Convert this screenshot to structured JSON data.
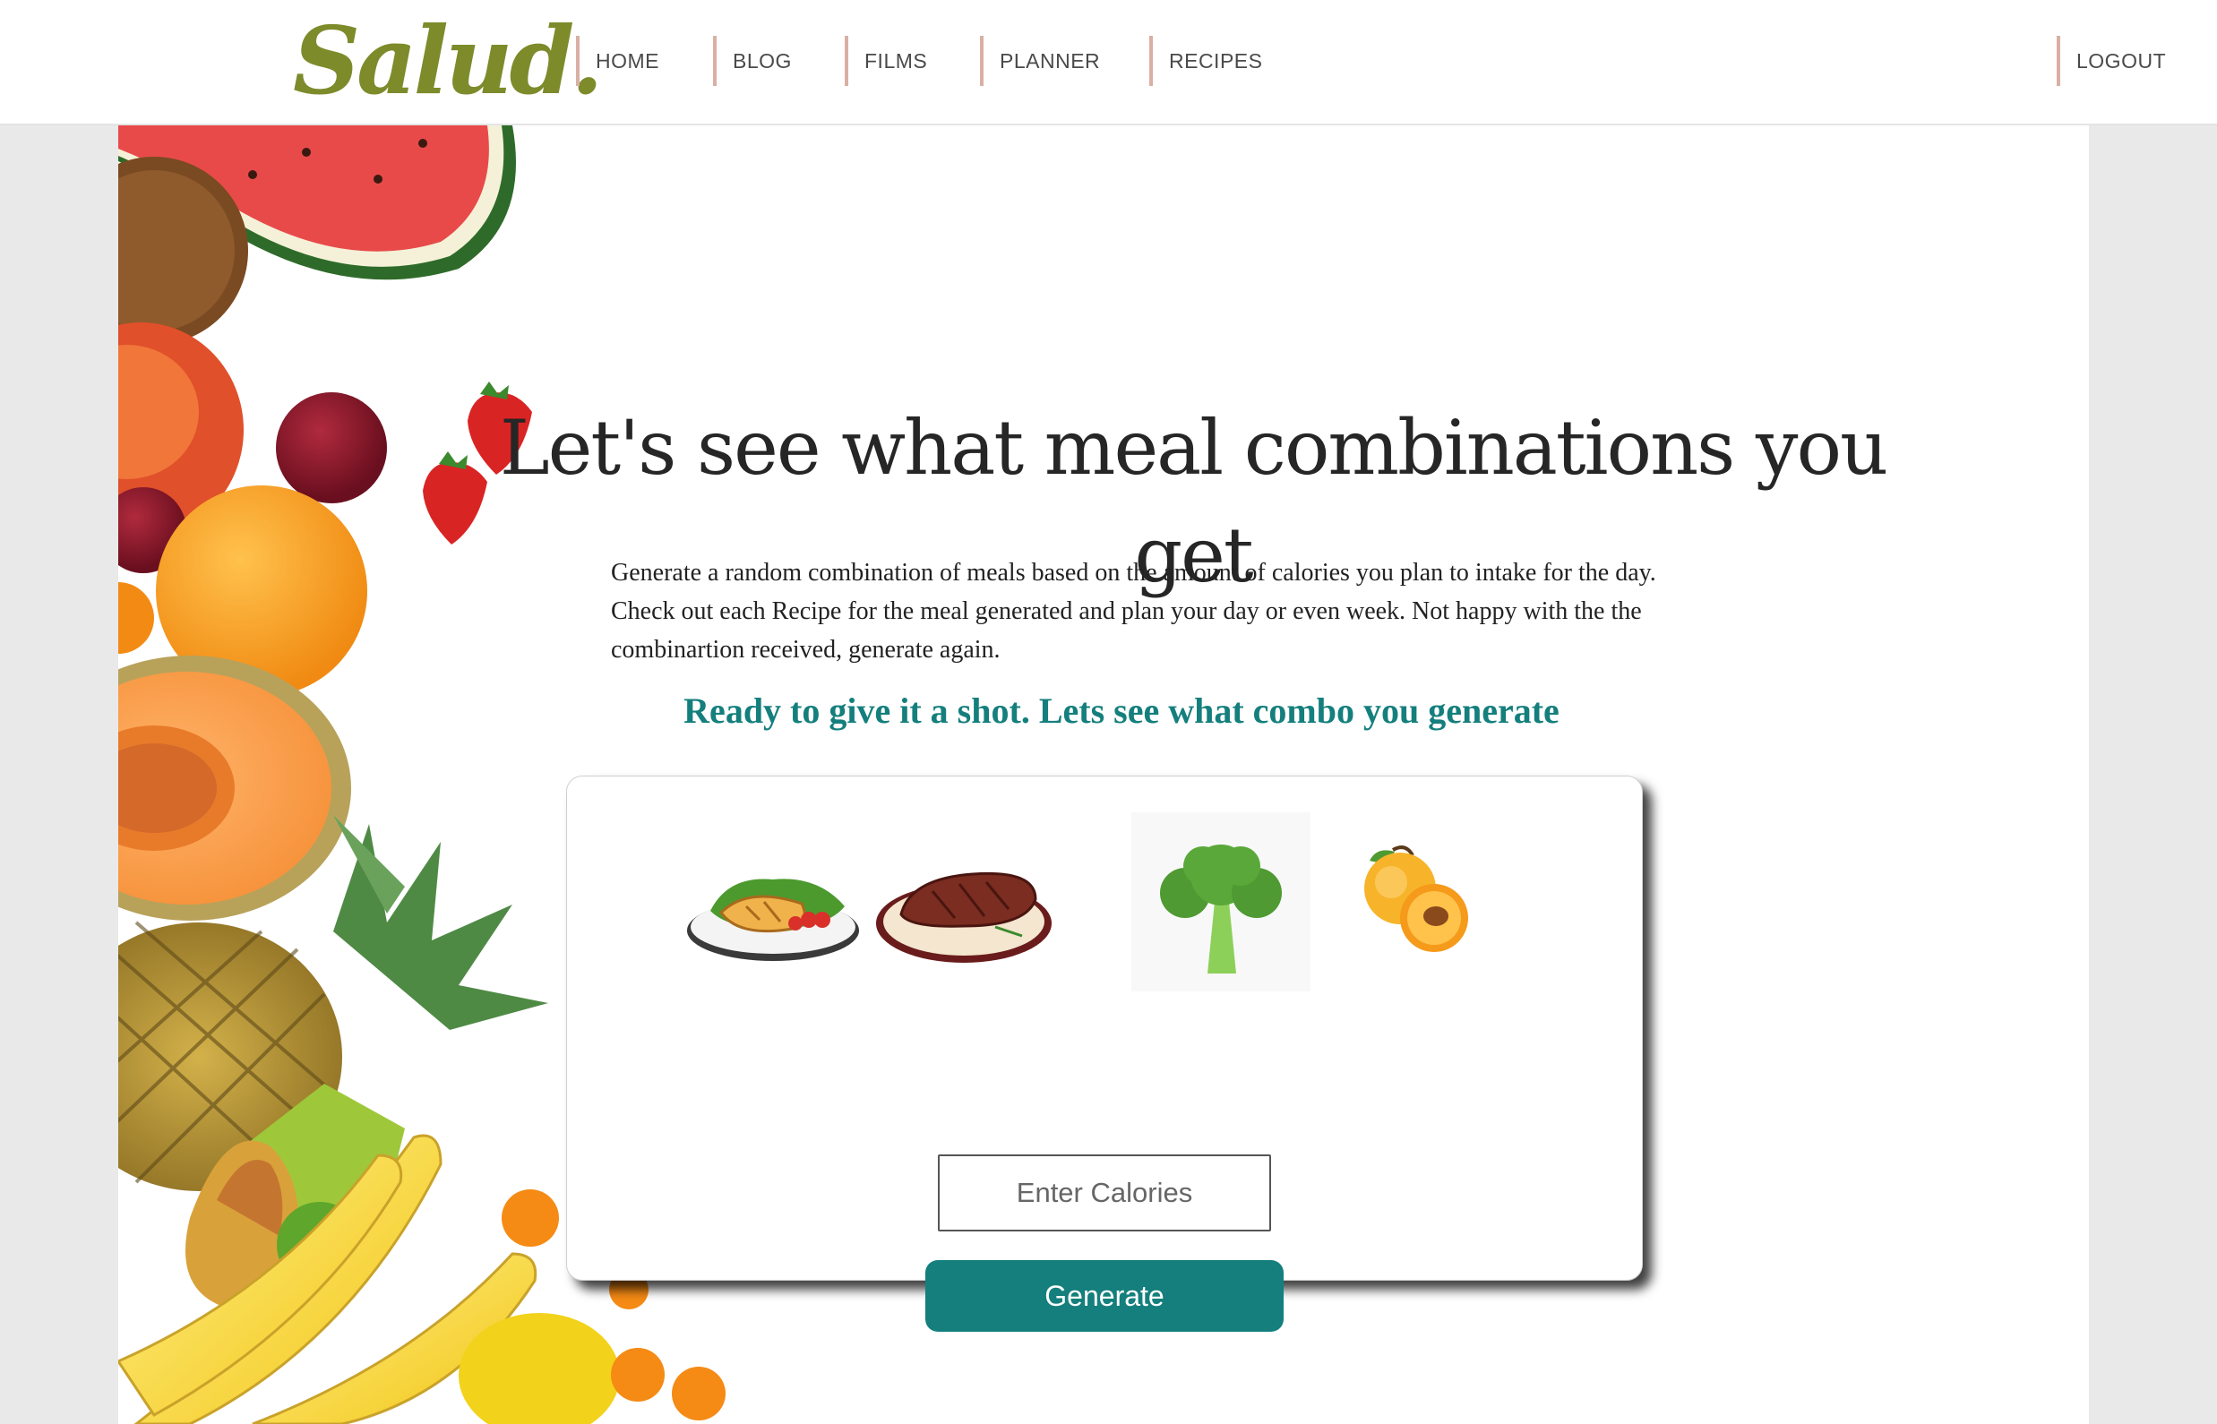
{
  "brand": {
    "logo": "Salud."
  },
  "nav": {
    "items": [
      {
        "id": "home",
        "label": "HOME"
      },
      {
        "id": "blog",
        "label": "BLOG"
      },
      {
        "id": "films",
        "label": "FILMS"
      },
      {
        "id": "planner",
        "label": "PLANNER"
      },
      {
        "id": "recipes",
        "label": "RECIPES"
      }
    ],
    "logout": "LOGOUT"
  },
  "hero": {
    "title": "Let's see what meal combinations you get",
    "description": "Generate a random combination of meals based on the amount of calories you plan to intake for the day. Check out each Recipe for the meal generated and plan your day or even week. Not happy with the the combinartion received, generate again.",
    "cta": "Ready to give it a shot. Lets see what combo you generate"
  },
  "generator": {
    "foods": [
      "grilled-chicken-plate-icon",
      "steak-plate-icon",
      "broccoli-icon",
      "peach-icon"
    ],
    "input_placeholder": "Enter Calories",
    "input_value": "",
    "button_label": "Generate"
  },
  "colors": {
    "brand": "#7d8b2b",
    "accent": "#147f7d",
    "nav_divider": "#d9b0a3",
    "page_bg": "#e9e9e9"
  }
}
